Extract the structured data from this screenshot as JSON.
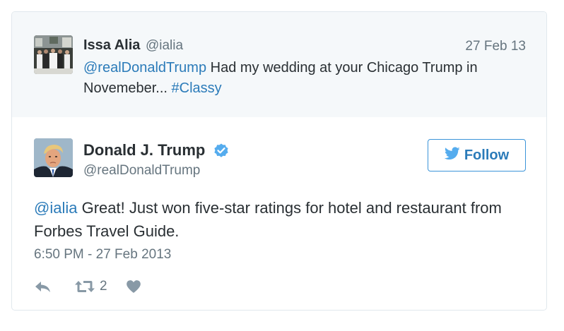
{
  "quoted_tweet": {
    "name": "Issa Alia",
    "handle": "@ialia",
    "date": "27 Feb 13",
    "mention": "@realDonaldTrump",
    "text_part1": " Had my wedding at your Chicago Trump in Novemeber... ",
    "hashtag": "#Classy",
    "avatar_icon": "wedding-photo-avatar"
  },
  "tweet": {
    "name": "Donald J. Trump",
    "screen_name": "@realDonaldTrump",
    "verified": true,
    "follow_label": "Follow",
    "mention": "@ialia",
    "text": " Great! Just won five-star ratings for hotel and restaurant from Forbes Travel Guide.",
    "timestamp": "6:50 PM - 27 Feb 2013",
    "retweet_count": "2",
    "avatar_icon": "profile-photo-avatar"
  },
  "icons": {
    "reply": "reply-icon",
    "retweet": "retweet-icon",
    "like": "heart-icon",
    "verified": "verified-badge-icon",
    "follow": "twitter-bird-icon"
  },
  "colors": {
    "link": "#2b7bb9",
    "muted": "#66757f",
    "icon": "#8899a6",
    "verified": "#55acee",
    "quoted_background": "#f5f8fa",
    "border": "#e1e8ed"
  }
}
